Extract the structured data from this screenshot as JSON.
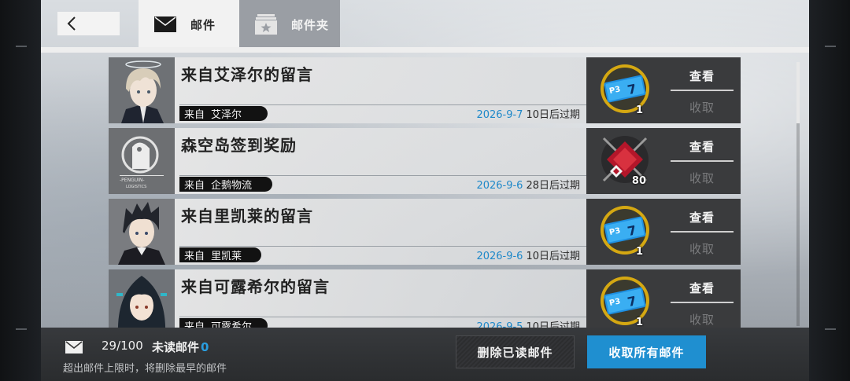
{
  "tabs": {
    "mail_label": "邮件",
    "folder_label": "邮件夹"
  },
  "mails": [
    {
      "title": "来自艾泽尔的留言",
      "sender_prefix": "来自",
      "sender": "艾泽尔",
      "date": "2026-9-7",
      "expiry": "10日后过期",
      "reward_count": "1",
      "view_label": "查看",
      "collect_label": "收取"
    },
    {
      "title": "森空岛签到奖励",
      "sender_prefix": "来自",
      "sender": "企鹅物流",
      "date": "2026-9-6",
      "expiry": "28日后过期",
      "reward_count": "80",
      "view_label": "查看",
      "collect_label": "收取"
    },
    {
      "title": "来自里凯莱的留言",
      "sender_prefix": "来自",
      "sender": "里凯莱",
      "date": "2026-9-6",
      "expiry": "10日后过期",
      "reward_count": "1",
      "view_label": "查看",
      "collect_label": "收取"
    },
    {
      "title": "来自可露希尔的留言",
      "sender_prefix": "来自",
      "sender": "可露希尔",
      "date": "2026-9-5",
      "expiry": "10日后过期",
      "reward_count": "1",
      "view_label": "查看",
      "collect_label": "收取"
    }
  ],
  "footer": {
    "count": "29/100",
    "unread_label": "未读邮件",
    "unread_count": "0",
    "hint": "超出邮件上限时，将删除最早的邮件",
    "delete_read_label": "删除已读邮件",
    "collect_all_label": "收取所有邮件"
  },
  "colors": {
    "accent_blue": "#1f8fd0",
    "date_blue": "#1e88c9",
    "unread_blue": "#2a9ee0"
  }
}
